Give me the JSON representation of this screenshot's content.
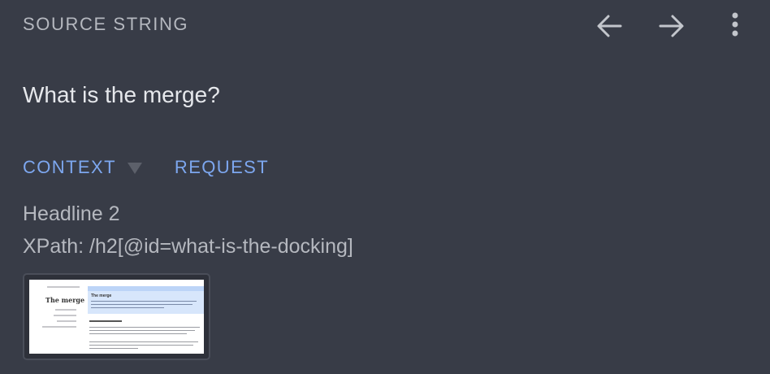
{
  "header": {
    "section_label": "SOURCE STRING",
    "prev_icon": "arrow-left-icon",
    "next_icon": "arrow-right-icon",
    "more_icon": "more-vertical-icon"
  },
  "source": {
    "text": "What is the merge?"
  },
  "tabs": [
    {
      "label": "CONTEXT"
    },
    {
      "label": "REQUEST"
    }
  ],
  "context": {
    "element_type": "Headline 2",
    "xpath": "XPath: /h2[@id=what-is-the-docking]"
  },
  "thumbnail": {
    "page_title": "The merge",
    "highlight_title": "The merge"
  },
  "colors": {
    "background": "#383c47",
    "label": "#b5b8bf",
    "text": "#e6e8ec",
    "accent": "#7da7ef"
  }
}
